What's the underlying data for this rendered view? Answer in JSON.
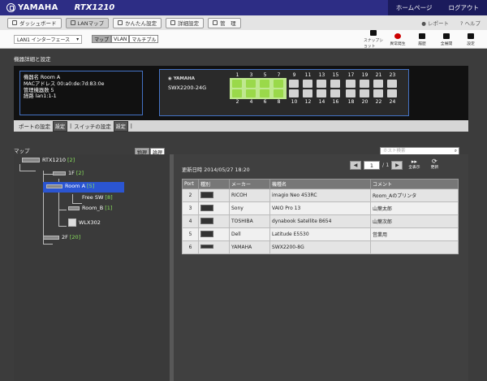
{
  "header": {
    "brand": "YAMAHA",
    "model": "RTX1210",
    "links": [
      "ホームページ",
      "ログアウト"
    ]
  },
  "menu": {
    "items": [
      {
        "label": "ダッシュボード",
        "icon": "dashboard-icon"
      },
      {
        "label": "LANマップ",
        "icon": "lanmap-icon"
      },
      {
        "label": "かんたん設定",
        "icon": "wand-icon"
      },
      {
        "label": "詳細設定",
        "icon": "gear-icon"
      },
      {
        "label": "管　理",
        "icon": "wrench-icon"
      }
    ],
    "right": {
      "report": "レポート",
      "help": "ヘルプ"
    }
  },
  "subbar": {
    "interface": "LAN1 インターフェース",
    "toggles": [
      "マップ",
      "VLAN",
      "マルチプル"
    ],
    "tools": [
      "スナップショット",
      "異常発生",
      "履歴",
      "全展開",
      "設定"
    ]
  },
  "detail": {
    "title": "機器詳細と設定",
    "info": [
      "機器名 Room A",
      "MACアドレス 00:a0:de:7d:83:0e",
      "管理機器数 5",
      "経路 lan1:1-1"
    ],
    "switch": {
      "brand": "YAMAHA",
      "model": "SWX2200-24G",
      "top_numbers": [
        "1",
        "3",
        "5",
        "7",
        "9",
        "11",
        "13",
        "15",
        "17",
        "19",
        "21",
        "23"
      ],
      "bottom_numbers": [
        "2",
        "4",
        "6",
        "8",
        "10",
        "12",
        "14",
        "16",
        "18",
        "20",
        "22",
        "24"
      ],
      "lit_ports": [
        "1",
        "3",
        "5",
        "7",
        "2",
        "4",
        "6",
        "8"
      ]
    },
    "port_setting": "ポートの設定",
    "switch_setting": "スイッチの設定",
    "set_label": "設定"
  },
  "map": {
    "title": "マップ",
    "view_toggle": [
      "物理",
      "論理"
    ],
    "search_placeholder": "ホスト検索",
    "tree": [
      {
        "name": "RTX1210",
        "count": "[2]"
      },
      {
        "name": "1F",
        "count": "[2]"
      },
      {
        "name": "Room A",
        "count": "[5]"
      },
      {
        "name": "Free SW",
        "count": "[8]"
      },
      {
        "name": "Room_B",
        "count": "[1]"
      },
      {
        "name": "WLX302",
        "count": ""
      },
      {
        "name": "2F",
        "count": "[20]"
      }
    ]
  },
  "list": {
    "updated": "更新日時 2014/05/27 18:20",
    "page": "1",
    "total": "/ 1",
    "expand_all": "全表示",
    "refresh": "更新",
    "columns": [
      "Port",
      "種別",
      "メーカー",
      "機種名",
      "コメント"
    ],
    "rows": [
      {
        "port": "2",
        "maker": "RICOH",
        "model": "imagio Neo 453RC",
        "comment": "Room_Aのプリンタ"
      },
      {
        "port": "3",
        "maker": "Sony",
        "model": "VAIO Pro 13",
        "comment": "山葉太郎"
      },
      {
        "port": "4",
        "maker": "TOSHIBA",
        "model": "dynabook Satellite B654",
        "comment": "山葉次郎"
      },
      {
        "port": "5",
        "maker": "Dell",
        "model": "Latitude E5530",
        "comment": "営業用"
      },
      {
        "port": "6",
        "maker": "YAMAHA",
        "model": "SWX2200-8G",
        "comment": ""
      }
    ]
  }
}
